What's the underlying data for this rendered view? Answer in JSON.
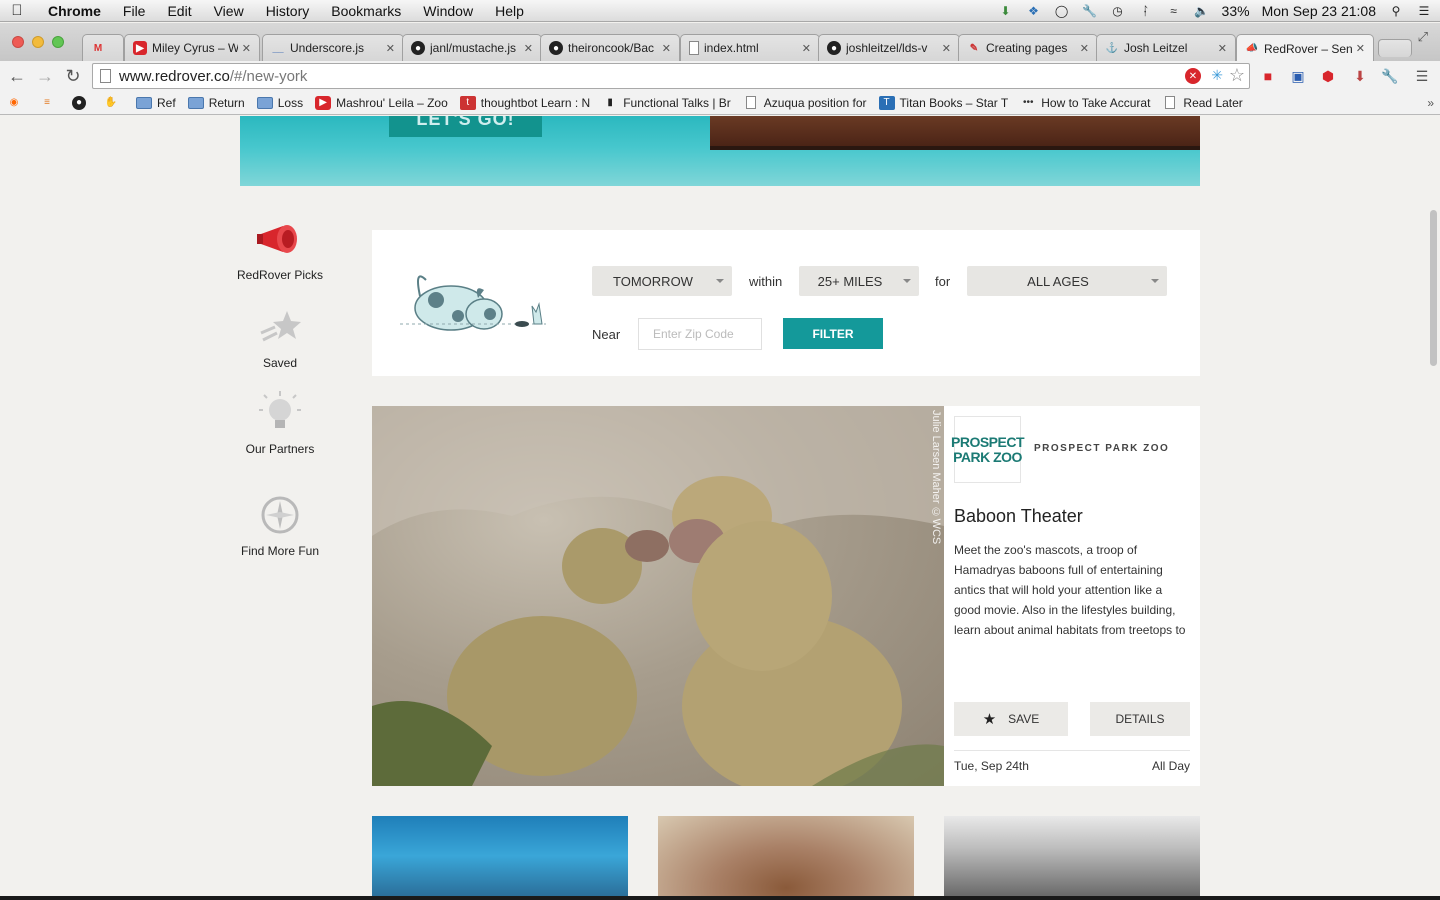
{
  "menubar": {
    "app": "Chrome",
    "items": [
      "File",
      "Edit",
      "View",
      "History",
      "Bookmarks",
      "Window",
      "Help"
    ],
    "battery": "33%",
    "clock": "Mon Sep 23  21:08"
  },
  "tabs": [
    {
      "label": "",
      "icon": "gmail-icon"
    },
    {
      "label": "Miley Cyrus – W",
      "icon": "youtube-icon"
    },
    {
      "label": "Underscore.js",
      "icon": "underscore-icon"
    },
    {
      "label": "janl/mustache.js",
      "icon": "github-icon"
    },
    {
      "label": "theironcook/Bac",
      "icon": "github-icon"
    },
    {
      "label": "index.html",
      "icon": "page-icon"
    },
    {
      "label": "joshleitzel/lds-v",
      "icon": "github-icon"
    },
    {
      "label": "Creating pages",
      "icon": "pencil-icon"
    },
    {
      "label": "Josh Leitzel",
      "icon": "anchor-icon"
    },
    {
      "label": "RedRover – Send",
      "icon": "megaphone-icon"
    }
  ],
  "address_bar": {
    "url_host": "www.redrover.co",
    "url_path": "/#/new-york"
  },
  "bookmarks": [
    {
      "label": "",
      "icon": "reddit-icon"
    },
    {
      "label": "",
      "icon": "stackoverflow-icon"
    },
    {
      "label": "",
      "icon": "github-icon"
    },
    {
      "label": "",
      "icon": "hand-icon"
    },
    {
      "label": "Ref",
      "icon": "folder-icon"
    },
    {
      "label": "Return",
      "icon": "folder-icon"
    },
    {
      "label": "Loss",
      "icon": "folder-icon"
    },
    {
      "label": "Mashrou' Leila – Zoo",
      "icon": "youtube-icon"
    },
    {
      "label": "thoughtbot Learn : N",
      "icon": "thoughtbot-icon"
    },
    {
      "label": "Functional Talks | Br",
      "icon": "speaker-icon"
    },
    {
      "label": "Azuqua position for",
      "icon": "page-icon"
    },
    {
      "label": "Titan Books – Star T",
      "icon": "titan-icon"
    },
    {
      "label": "How to Take Accurat",
      "icon": "dots-icon"
    },
    {
      "label": "Read Later",
      "icon": "page-icon"
    }
  ],
  "hero": {
    "cta_label": "LET'S GO!"
  },
  "sidebar": {
    "items": [
      {
        "label": "RedRover Picks",
        "icon": "megaphone-icon"
      },
      {
        "label": "Saved",
        "icon": "shooting-star-icon"
      },
      {
        "label": "Our Partners",
        "icon": "lightbulb-icon"
      },
      {
        "label": "Find More Fun",
        "icon": "compass-icon"
      }
    ]
  },
  "filter": {
    "when": "TOMORROW",
    "within_label": "within",
    "distance": "25+ MILES",
    "for_label": "for",
    "ages": "ALL AGES",
    "near_label": "Near",
    "zip_placeholder": "Enter Zip Code",
    "filter_button": "FILTER"
  },
  "featured": {
    "photo_credit": "Julie Larsen Maher ©WCS",
    "partner_logo_text": "PROSPECT PARK ZOO",
    "partner_name": "PROSPECT PARK ZOO",
    "title": "Baboon Theater",
    "description": "Meet the zoo's mascots, a troop of Hamadryas baboons full of entertaining antics that will hold your attention like a good movie. Also in the lifestyles building, learn about animal habitats from treetops to",
    "save_label": "SAVE",
    "details_label": "DETAILS",
    "date": "Tue, Sep 24th",
    "time": "All Day"
  },
  "colors": {
    "teal": "#14999a",
    "red": "#d8262c",
    "page_bg": "#f2f1ee"
  }
}
